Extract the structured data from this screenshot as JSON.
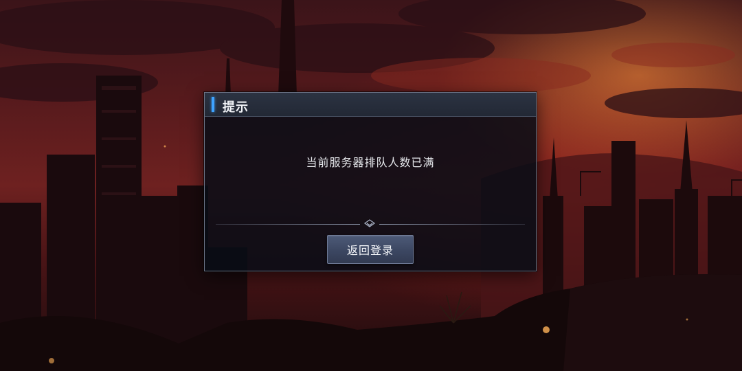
{
  "dialog": {
    "title": "提示",
    "message": "当前服务器排队人数已满",
    "confirm_label": "返回登录"
  },
  "colors": {
    "accent": "#3ea3ff",
    "dialog_bg": "#080d16",
    "button_bg": "#3c4762",
    "sky_glow": "#e8783c"
  },
  "icons": {
    "divider": "diamond-chevron-icon"
  }
}
